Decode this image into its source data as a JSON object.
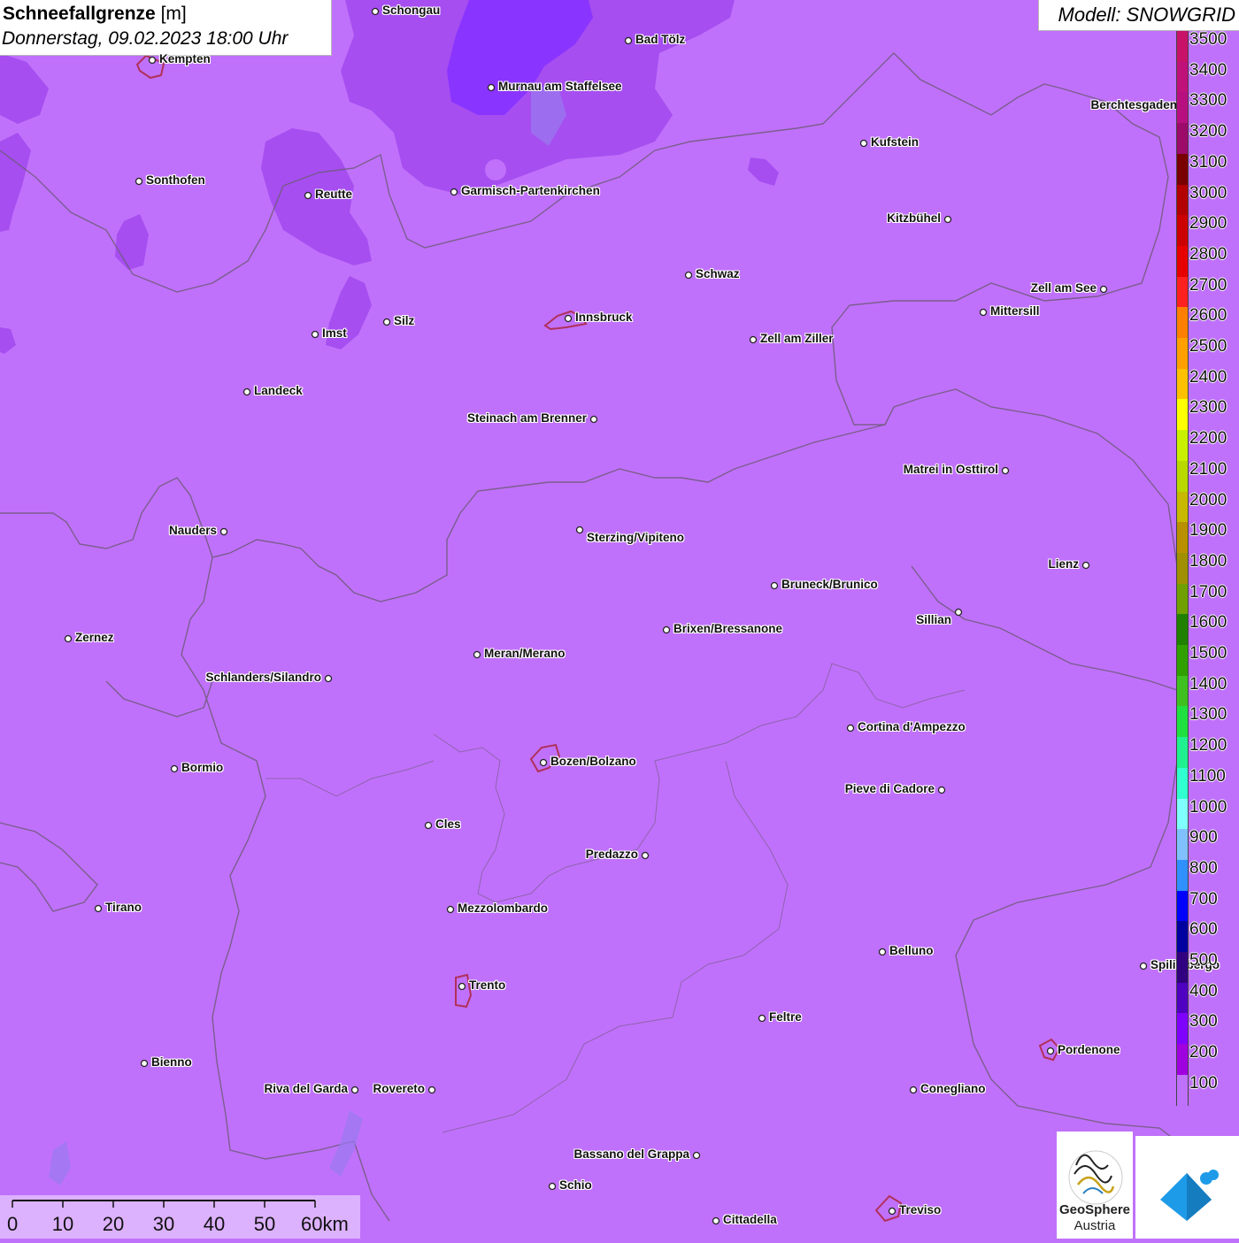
{
  "title": {
    "main": "Schneefallgrenze",
    "unit": "[m]",
    "date": "Donnerstag, 09.02.2023 18:00 Uhr"
  },
  "model": "Modell: SNOWGRID",
  "colors": {
    "base": "#c071fb",
    "zone_mid": "#a64ef0",
    "zone_dark": "#9838f0",
    "zone_deep": "#8a34ff",
    "border": "#6e5a7a",
    "city_outline": "#b0305a"
  },
  "cities": [
    {
      "name": "Schongau",
      "dot": [
        424,
        13
      ],
      "label_side": "right"
    },
    {
      "name": "Bad Tölz",
      "dot": [
        710,
        46
      ],
      "label_side": "right"
    },
    {
      "name": "Kempten",
      "dot": [
        172,
        68
      ],
      "label_side": "right"
    },
    {
      "name": "Murnau am Staffelsee",
      "dot": [
        555,
        99
      ],
      "label_side": "right"
    },
    {
      "name": "Berchtesgaden",
      "dot": [
        1338,
        120
      ],
      "label_side": "left"
    },
    {
      "name": "Kufstein",
      "dot": [
        976,
        162
      ],
      "label_side": "right"
    },
    {
      "name": "Sonthofen",
      "dot": [
        157,
        205
      ],
      "label_side": "right"
    },
    {
      "name": "Reutte",
      "dot": [
        348,
        221
      ],
      "label_side": "right"
    },
    {
      "name": "Garmisch-Partenkirchen",
      "dot": [
        513,
        217
      ],
      "label_side": "right"
    },
    {
      "name": "Kitzbühel",
      "dot": [
        1071,
        248
      ],
      "label_side": "left"
    },
    {
      "name": "Schwaz",
      "dot": [
        778,
        311
      ],
      "label_side": "right"
    },
    {
      "name": "Zell am See",
      "dot": [
        1247,
        327
      ],
      "label_side": "left"
    },
    {
      "name": "Mittersill",
      "dot": [
        1111,
        353
      ],
      "label_side": "right"
    },
    {
      "name": "Innsbruck",
      "dot": [
        642,
        360
      ],
      "label_side": "right"
    },
    {
      "name": "Silz",
      "dot": [
        437,
        364
      ],
      "label_side": "right"
    },
    {
      "name": "Imst",
      "dot": [
        356,
        378
      ],
      "label_side": "right"
    },
    {
      "name": "Zell am Ziller",
      "dot": [
        851,
        384
      ],
      "label_side": "right"
    },
    {
      "name": "Landeck",
      "dot": [
        279,
        443
      ],
      "label_side": "right"
    },
    {
      "name": "Steinach am Brenner",
      "dot": [
        671,
        474
      ],
      "label_side": "left"
    },
    {
      "name": "Matrei in Osttirol",
      "dot": [
        1136,
        532
      ],
      "label_side": "left"
    },
    {
      "name": "Nauders",
      "dot": [
        253,
        601
      ],
      "label_side": "left"
    },
    {
      "name": "Sterzing/Vipiteno",
      "dot": [
        655,
        599
      ],
      "label_side": "belowright"
    },
    {
      "name": "Lienz",
      "dot": [
        1227,
        639
      ],
      "label_side": "left"
    },
    {
      "name": "Bruneck/Brunico",
      "dot": [
        875,
        662
      ],
      "label_side": "right"
    },
    {
      "name": "Sillian",
      "dot": [
        1083,
        692
      ],
      "label_side": "belowleft"
    },
    {
      "name": "Brixen/Bressanone",
      "dot": [
        753,
        712
      ],
      "label_side": "right"
    },
    {
      "name": "Zernez",
      "dot": [
        77,
        722
      ],
      "label_side": "right"
    },
    {
      "name": "Meran/Merano",
      "dot": [
        539,
        740
      ],
      "label_side": "right"
    },
    {
      "name": "Schlanders/Silandro",
      "dot": [
        371,
        767
      ],
      "label_side": "left"
    },
    {
      "name": "Cortina d'Ampezzo",
      "dot": [
        961,
        823
      ],
      "label_side": "right"
    },
    {
      "name": "Bozen/Bolzano",
      "dot": [
        614,
        862
      ],
      "label_side": "right"
    },
    {
      "name": "Bormio",
      "dot": [
        197,
        869
      ],
      "label_side": "right"
    },
    {
      "name": "Pieve di Cadore",
      "dot": [
        1064,
        893
      ],
      "label_side": "left"
    },
    {
      "name": "Cles",
      "dot": [
        484,
        933
      ],
      "label_side": "right"
    },
    {
      "name": "Predazzo",
      "dot": [
        729,
        967
      ],
      "label_side": "left"
    },
    {
      "name": "Tirano",
      "dot": [
        111,
        1027
      ],
      "label_side": "right"
    },
    {
      "name": "Mezzolombardo",
      "dot": [
        509,
        1028
      ],
      "label_side": "right"
    },
    {
      "name": "Belluno",
      "dot": [
        997,
        1076
      ],
      "label_side": "right"
    },
    {
      "name": "Spilimbergo",
      "dot": [
        1292,
        1092
      ],
      "label_side": "right"
    },
    {
      "name": "Trento",
      "dot": [
        522,
        1115
      ],
      "label_side": "right"
    },
    {
      "name": "Feltre",
      "dot": [
        861,
        1151
      ],
      "label_side": "right"
    },
    {
      "name": "Pordenone",
      "dot": [
        1187,
        1188
      ],
      "label_side": "right"
    },
    {
      "name": "Bienno",
      "dot": [
        163,
        1202
      ],
      "label_side": "right"
    },
    {
      "name": "Riva del Garda",
      "dot": [
        401,
        1232
      ],
      "label_side": "left"
    },
    {
      "name": "Rovereto",
      "dot": [
        488,
        1232
      ],
      "label_side": "left"
    },
    {
      "name": "Conegliano",
      "dot": [
        1032,
        1232
      ],
      "label_side": "right"
    },
    {
      "name": "Bassano del Grappa",
      "dot": [
        787,
        1306
      ],
      "label_side": "left"
    },
    {
      "name": "Schio",
      "dot": [
        624,
        1341
      ],
      "label_side": "right"
    },
    {
      "name": "Treviso",
      "dot": [
        1008,
        1369
      ],
      "label_side": "right"
    },
    {
      "name": "Cittadella",
      "dot": [
        809,
        1380
      ],
      "label_side": "right"
    }
  ],
  "legend": {
    "values": [
      3500,
      3400,
      3300,
      3200,
      3100,
      3000,
      2900,
      2800,
      2700,
      2600,
      2500,
      2400,
      2300,
      2200,
      2100,
      2000,
      1900,
      1800,
      1700,
      1600,
      1500,
      1400,
      1300,
      1200,
      1100,
      1000,
      900,
      800,
      700,
      600,
      500,
      400,
      300,
      200,
      100
    ],
    "labels": [
      "3500",
      "3400",
      "3300",
      "3200",
      "3100",
      "3000",
      "2900",
      "2800",
      "2700",
      "2600",
      "2500",
      "2400",
      "2300",
      "2200",
      "2100",
      "2000",
      "1900",
      "1800",
      "1700",
      "1600",
      "1500",
      "1400",
      "1300",
      "1200",
      "1100",
      "1000",
      "900",
      "800",
      "700",
      "600",
      "500",
      "400",
      "300",
      "200",
      "100"
    ],
    "colors": [
      "#c8126a",
      "#c0107a",
      "#b80f80",
      "#9c0a6a",
      "#7a0000",
      "#b30000",
      "#cc0000",
      "#e60000",
      "#ff2020",
      "#ff8000",
      "#ffa000",
      "#ffc000",
      "#ffff00",
      "#c8f000",
      "#b8d800",
      "#c8b800",
      "#b89000",
      "#a09000",
      "#70a000",
      "#208000",
      "#30a000",
      "#40c020",
      "#20e040",
      "#20f090",
      "#30ffd0",
      "#80ffff",
      "#80c0ff",
      "#3090ff",
      "#0000ff",
      "#0000a0",
      "#300080",
      "#5000c0",
      "#8000ff",
      "#a000e0",
      "#c071fb"
    ]
  },
  "scale_bar": {
    "labels": [
      "0",
      "10",
      "20",
      "30",
      "40",
      "50",
      "60km"
    ]
  },
  "logos": {
    "geosphere_line1": "GeoSphere",
    "geosphere_line2": "Austria"
  }
}
